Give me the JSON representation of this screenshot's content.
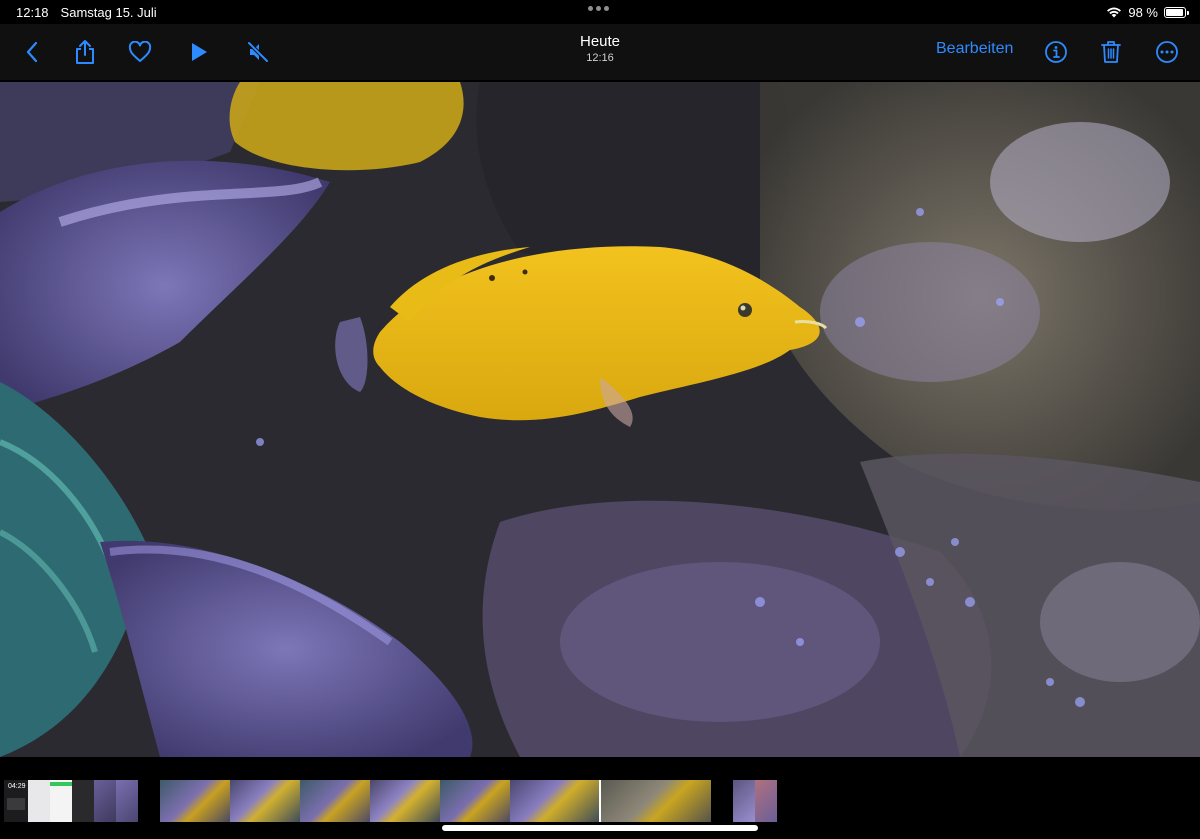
{
  "status_bar": {
    "time": "12:18",
    "date": "Samstag 15. Juli",
    "battery_text": "98 %",
    "battery_level": 0.98
  },
  "toolbar": {
    "title": "Heute",
    "subtitle": "12:16",
    "edit_label": "Bearbeiten",
    "icons": {
      "back": "chevron-left-icon",
      "share": "share-icon",
      "favorite": "heart-icon",
      "play": "play-icon",
      "mute": "speaker-muted-icon",
      "info": "info-icon",
      "delete": "trash-icon",
      "more": "more-icon"
    },
    "accent_color": "#2e8bff"
  },
  "filmstrip": {
    "first_thumb_label": "04:29",
    "playhead_position": 0.5
  }
}
